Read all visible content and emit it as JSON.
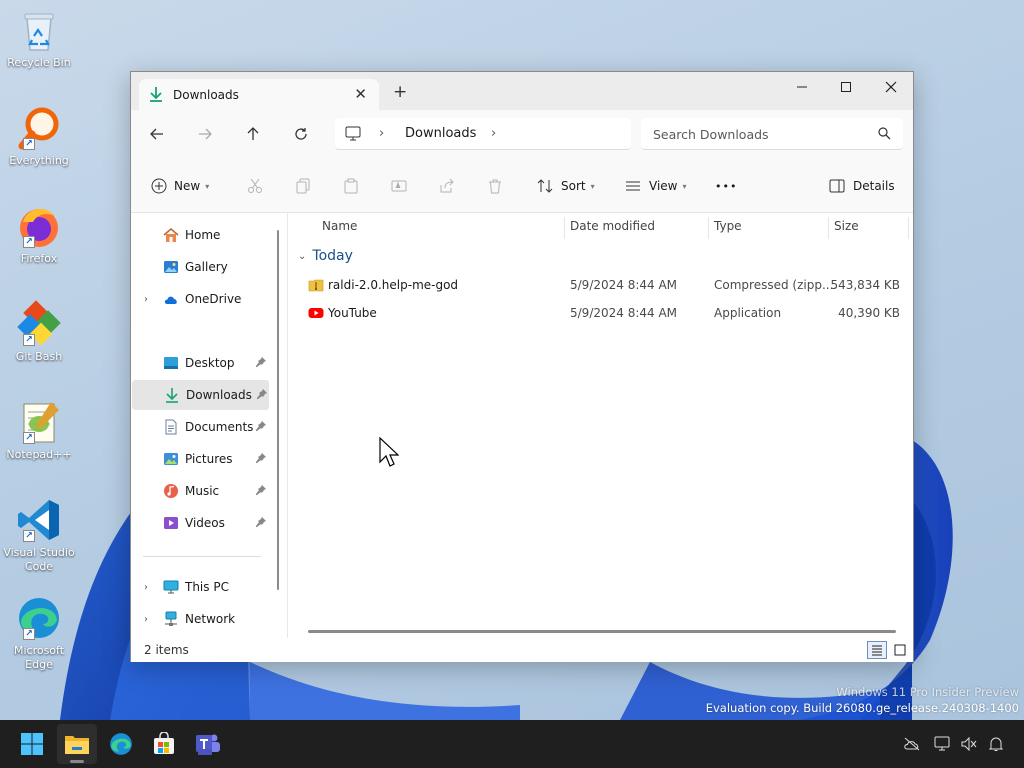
{
  "desktop": {
    "icons": [
      {
        "label": "Recycle Bin",
        "icon": "recycle-bin-icon"
      },
      {
        "label": "Everything",
        "icon": "everything-search-icon"
      },
      {
        "label": "Firefox",
        "icon": "firefox-icon"
      },
      {
        "label": "Git Bash",
        "icon": "git-bash-icon"
      },
      {
        "label": "Notepad++",
        "icon": "notepadpp-icon"
      },
      {
        "label": "Visual Studio Code",
        "icon": "vscode-icon"
      },
      {
        "label": "Microsoft Edge",
        "icon": "edge-icon"
      }
    ],
    "watermark": {
      "line1": "Windows 11 Pro Insider Preview",
      "line2": "Evaluation copy. Build 26080.ge_release.240308-1400"
    }
  },
  "window": {
    "tab_title": "Downloads",
    "new_tab_symbol": "+",
    "address": {
      "crumb": "Downloads",
      "separator": "›"
    },
    "search": {
      "placeholder": "Search Downloads"
    },
    "command_bar": {
      "new_label": "New",
      "sort_label": "Sort",
      "view_label": "View",
      "more_label": "•••",
      "details_label": "Details"
    },
    "nav_pane": {
      "home": "Home",
      "gallery": "Gallery",
      "onedrive": "OneDrive",
      "desktop": "Desktop",
      "downloads": "Downloads",
      "documents": "Documents",
      "pictures": "Pictures",
      "music": "Music",
      "videos": "Videos",
      "this_pc": "This PC",
      "network": "Network"
    },
    "columns": {
      "name": "Name",
      "date_modified": "Date modified",
      "type": "Type",
      "size": "Size"
    },
    "group_label": "Today",
    "files": [
      {
        "name": "raldi-2.0.help-me-god",
        "date": "5/9/2024 8:44 AM",
        "type": "Compressed (zipp...",
        "size": "543,834 KB",
        "icon": "zip-folder-icon"
      },
      {
        "name": "YouTube",
        "date": "5/9/2024 8:44 AM",
        "type": "Application",
        "size": "40,390 KB",
        "icon": "youtube-icon"
      }
    ],
    "status": {
      "item_count": "2 items"
    }
  },
  "colors": {
    "accent": "#0067c0",
    "selected_nav": "#e5e5e5",
    "group_header": "#1b4f8a",
    "taskbar": "#1f1f1f"
  }
}
